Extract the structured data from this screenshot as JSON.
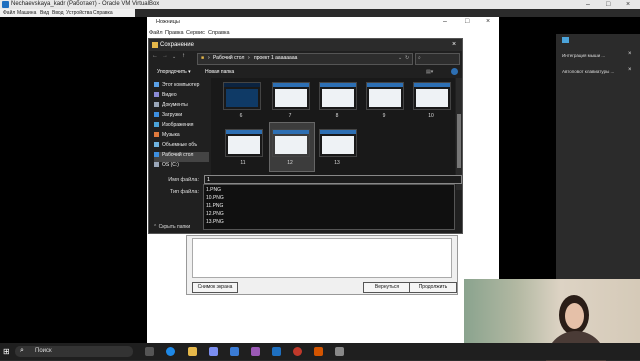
{
  "vbox": {
    "title": "Nechaevskaya_kadr (Работает) - Oracle VM VirtualBox",
    "menu": [
      "Файл",
      "Машина",
      "Вид",
      "Ввод",
      "Устройства",
      "Справка"
    ]
  },
  "explorer": {
    "title": "Ножницы",
    "menu": [
      "Файл",
      "Правка",
      "Сервис",
      "Справка"
    ]
  },
  "app_panel": {
    "snapshot_button": "Снимок экрана",
    "back_button": "Вернуться",
    "continue_button": "Продолжить"
  },
  "dialog": {
    "title": "Сохранение",
    "breadcrumb": [
      "Рабочий стол",
      "проект 1 аааааааа"
    ],
    "toolbar": {
      "organize": "Упорядочить ▾",
      "new_folder": "Новая папка"
    },
    "nav_items": [
      {
        "label": "Этот компьютер",
        "icon": "computer-icon",
        "color": "#5aa0e6"
      },
      {
        "label": "Видео",
        "icon": "video-icon",
        "color": "#8a8ad6"
      },
      {
        "label": "Документы",
        "icon": "documents-icon",
        "color": "#9aa6b8"
      },
      {
        "label": "Загрузки",
        "icon": "download-icon",
        "color": "#3d8fe0"
      },
      {
        "label": "Изображения",
        "icon": "pictures-icon",
        "color": "#4ba3d9"
      },
      {
        "label": "Музыка",
        "icon": "music-icon",
        "color": "#e07a3d"
      },
      {
        "label": "Объемные объ",
        "icon": "3d-objects-icon",
        "color": "#6fb3e0"
      },
      {
        "label": "Рабочий стол",
        "icon": "desktop-icon",
        "color": "#3d8fe0"
      },
      {
        "label": "OS (C:)",
        "icon": "drive-icon",
        "color": "#9aa6b8"
      }
    ],
    "files": [
      {
        "label": "6",
        "style": "dark"
      },
      {
        "label": "7",
        "style": "light"
      },
      {
        "label": "8",
        "style": "light"
      },
      {
        "label": "9",
        "style": "light"
      },
      {
        "label": "10",
        "style": "light"
      },
      {
        "label": "11",
        "style": "light"
      },
      {
        "label": "12",
        "style": "light"
      },
      {
        "label": "13",
        "style": "light"
      }
    ],
    "filename_label": "Имя файла:",
    "filetype_label": "Тип файла:",
    "filename_value": "1",
    "suggestions": [
      "1.PNG",
      "10.PNG",
      "11.PNG",
      "12.PNG",
      "13.PNG"
    ],
    "hide_folders": "Скрыть папки"
  },
  "side_panel": {
    "items": [
      "Интеграция мыши ...",
      "Автоповот клавиатуры ..."
    ]
  },
  "taskbar": {
    "search_placeholder": "Поиск"
  }
}
